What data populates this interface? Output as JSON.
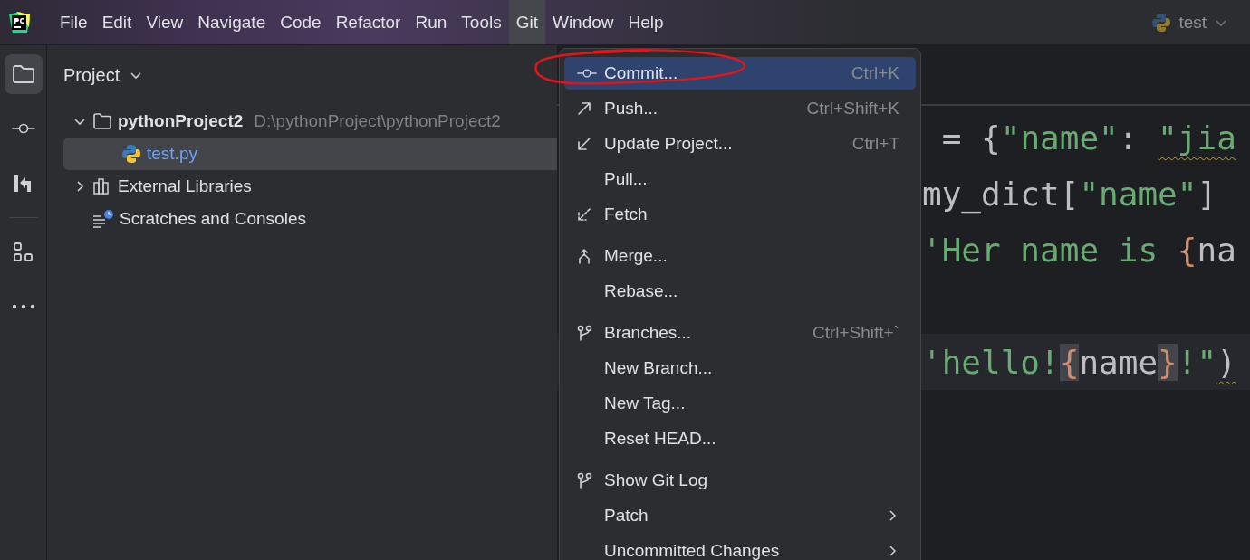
{
  "menu_bar": {
    "items": [
      {
        "label": "File",
        "selected": false
      },
      {
        "label": "Edit",
        "selected": false
      },
      {
        "label": "View",
        "selected": false
      },
      {
        "label": "Navigate",
        "selected": false
      },
      {
        "label": "Code",
        "selected": false
      },
      {
        "label": "Refactor",
        "selected": false
      },
      {
        "label": "Run",
        "selected": false
      },
      {
        "label": "Tools",
        "selected": false
      },
      {
        "label": "Git",
        "selected": true
      },
      {
        "label": "Window",
        "selected": false
      },
      {
        "label": "Help",
        "selected": false
      }
    ],
    "run_config": {
      "label": "test"
    }
  },
  "tool_strip": {
    "items": [
      {
        "selected": true
      },
      {
        "selected": false
      },
      {
        "selected": false
      },
      {
        "selected": false
      },
      {
        "selected": false
      }
    ]
  },
  "project_panel": {
    "title": "Project",
    "tree": [
      {
        "label": "pythonProject2",
        "hint": "D:\\pythonProject\\pythonProject2",
        "expanded": true,
        "selected": false,
        "children": [
          {
            "label": "test.py",
            "selected": true
          }
        ]
      },
      {
        "label": "External Libraries",
        "expanded": false,
        "selected": false
      },
      {
        "label": "Scratches and Consoles",
        "selected": false
      }
    ]
  },
  "editor": {
    "lines": [
      {
        "current": false,
        "tokens": [
          {
            "text": " = {",
            "kind": "plain"
          },
          {
            "text": "\"name\"",
            "kind": "string"
          },
          {
            "text": ": ",
            "kind": "plain"
          },
          {
            "text": "\"jia",
            "kind": "string",
            "warning": true
          }
        ]
      },
      {
        "current": false,
        "tokens": [
          {
            "text": "my_dict[",
            "kind": "plain"
          },
          {
            "text": "\"name\"",
            "kind": "string"
          },
          {
            "text": "]",
            "kind": "plain"
          }
        ]
      },
      {
        "current": false,
        "tokens": [
          {
            "text": "'Her name is ",
            "kind": "string"
          },
          {
            "text": "{",
            "kind": "brace"
          },
          {
            "text": "na",
            "kind": "plain"
          }
        ]
      },
      {
        "current": true,
        "tokens": [
          {
            "text": "'hello!",
            "kind": "string"
          },
          {
            "text": "{",
            "kind": "brace",
            "matched": true
          },
          {
            "text": "name",
            "kind": "plain"
          },
          {
            "text": "}",
            "kind": "brace",
            "matched": true
          },
          {
            "text": "!\"",
            "kind": "string"
          },
          {
            "text": ")",
            "kind": "plain",
            "warning": true
          }
        ]
      }
    ]
  },
  "git_menu": {
    "sections": [
      [
        {
          "label": "Commit...",
          "shortcut": "Ctrl+K",
          "selected": true,
          "submenu": false
        },
        {
          "label": "Push...",
          "shortcut": "Ctrl+Shift+K",
          "selected": false,
          "submenu": false
        },
        {
          "label": "Update Project...",
          "shortcut": "Ctrl+T",
          "selected": false,
          "submenu": false
        },
        {
          "label": "Pull...",
          "selected": false,
          "submenu": false
        },
        {
          "label": "Fetch",
          "selected": false,
          "submenu": false
        }
      ],
      [
        {
          "label": "Merge...",
          "selected": false,
          "submenu": false
        },
        {
          "label": "Rebase...",
          "selected": false,
          "submenu": false
        }
      ],
      [
        {
          "label": "Branches...",
          "shortcut": "Ctrl+Shift+`",
          "selected": false,
          "submenu": false
        },
        {
          "label": "New Branch...",
          "selected": false,
          "submenu": false
        },
        {
          "label": "New Tag...",
          "selected": false,
          "submenu": false
        },
        {
          "label": "Reset HEAD...",
          "selected": false,
          "submenu": false
        }
      ],
      [
        {
          "label": "Show Git Log",
          "selected": false,
          "submenu": false
        },
        {
          "label": "Patch",
          "selected": false,
          "submenu": true
        },
        {
          "label": "Uncommitted Changes",
          "selected": false,
          "submenu": true
        }
      ]
    ]
  },
  "annotation": {
    "kind": "ellipse",
    "color": "#e3141b"
  }
}
